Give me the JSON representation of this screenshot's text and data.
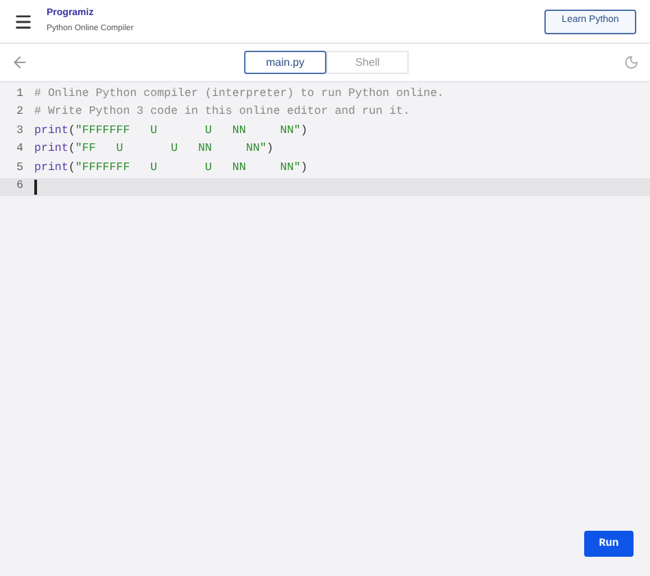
{
  "header": {
    "logo": "Programiz",
    "subtitle": "Python Online Compiler",
    "learn_button": "Learn Python"
  },
  "tabs": [
    {
      "label": "main.py",
      "selected": true
    },
    {
      "label": "Shell",
      "selected": false
    }
  ],
  "editor": {
    "lines": [
      {
        "number": "1",
        "kind": "comment",
        "text": "# Online Python compiler (interpreter) to run Python online.",
        "current": false
      },
      {
        "number": "2",
        "kind": "comment",
        "text": "# Write Python 3 code in this online editor and run it.",
        "current": false
      },
      {
        "number": "3",
        "kind": "call",
        "func": "print",
        "open": "(",
        "string": "\"FFFFFFF   U       U   NN     NN\"",
        "close": ")",
        "current": false
      },
      {
        "number": "4",
        "kind": "call",
        "func": "print",
        "open": "(",
        "string": "\"FF   U       U   NN     NN\"",
        "close": ")",
        "current": false
      },
      {
        "number": "5",
        "kind": "call",
        "func": "print",
        "open": "(",
        "string": "\"FFFFFFF   U       U   NN     NN\"",
        "close": ")",
        "current": false
      },
      {
        "number": "6",
        "kind": "empty",
        "current": true
      }
    ]
  },
  "run_button": "Run"
}
